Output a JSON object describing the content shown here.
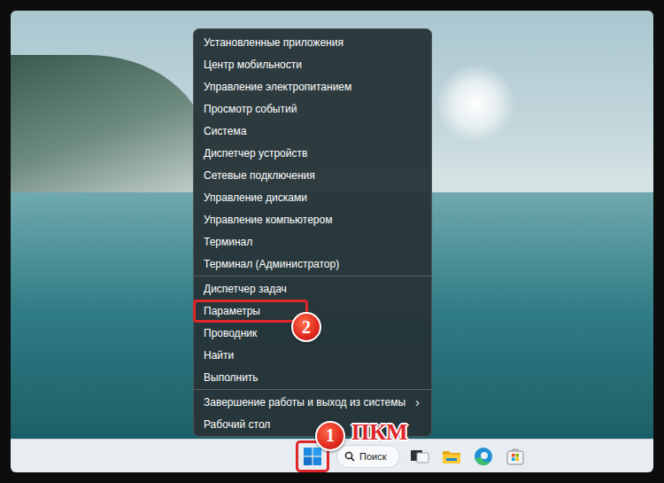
{
  "menu": {
    "groups": [
      [
        {
          "label": "Установленные приложения"
        },
        {
          "label": "Центр мобильности"
        },
        {
          "label": "Управление электропитанием"
        },
        {
          "label": "Просмотр событий"
        },
        {
          "label": "Система"
        },
        {
          "label": "Диспетчер устройств"
        },
        {
          "label": "Сетевые подключения"
        },
        {
          "label": "Управление дисками"
        },
        {
          "label": "Управление компьютером"
        },
        {
          "label": "Терминал"
        },
        {
          "label": "Терминал (Администратор)"
        }
      ],
      [
        {
          "label": "Диспетчер задач"
        },
        {
          "label": "Параметры"
        },
        {
          "label": "Проводник"
        },
        {
          "label": "Найти"
        },
        {
          "label": "Выполнить"
        }
      ],
      [
        {
          "label": "Завершение работы и выход из системы",
          "arrow": "›"
        },
        {
          "label": "Рабочий стол"
        }
      ]
    ]
  },
  "taskbar": {
    "search": {
      "placeholder": "Поиск"
    }
  },
  "annotations": {
    "start_button": {
      "number": "1",
      "label": "ПКМ"
    },
    "menu_item": {
      "number": "2",
      "item": "Параметры"
    }
  }
}
